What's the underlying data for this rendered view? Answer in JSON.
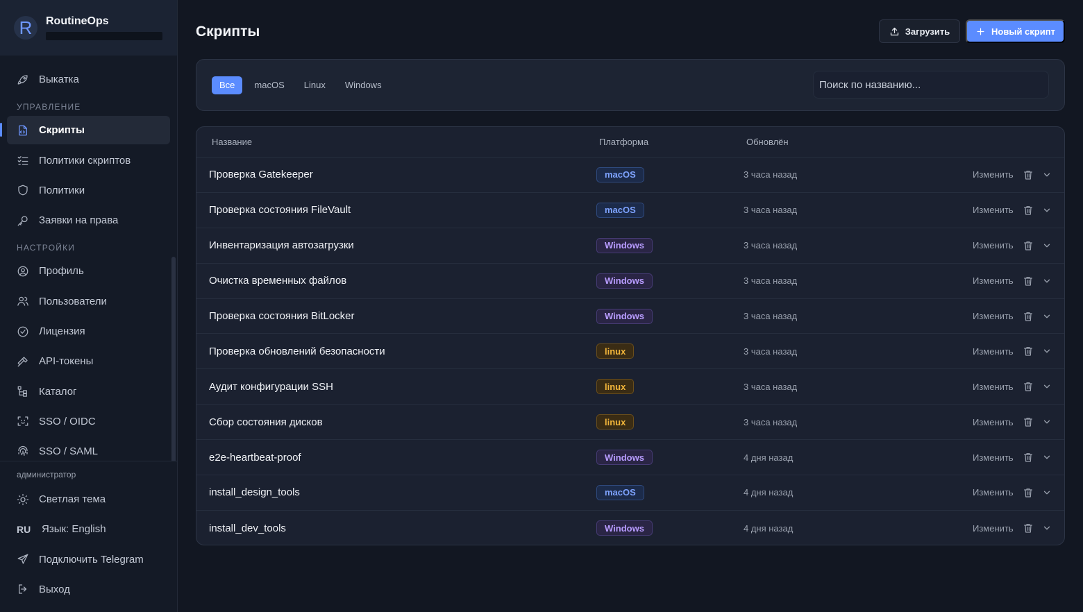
{
  "brand": {
    "name": "RoutineOps",
    "logo_letter": "R"
  },
  "sidebar": {
    "top_items": [
      {
        "label": "Выкатка",
        "icon": "rocket-icon"
      }
    ],
    "sections": [
      {
        "title": "УПРАВЛЕНИЕ",
        "items": [
          {
            "label": "Скрипты",
            "icon": "script-file-icon",
            "active": true
          },
          {
            "label": "Политики скриптов",
            "icon": "checklist-icon"
          },
          {
            "label": "Политики",
            "icon": "shield-icon"
          },
          {
            "label": "Заявки на права",
            "icon": "key-icon"
          }
        ]
      },
      {
        "title": "НАСТРОЙКИ",
        "items": [
          {
            "label": "Профиль",
            "icon": "user-circle-icon"
          },
          {
            "label": "Пользователи",
            "icon": "users-icon"
          },
          {
            "label": "Лицензия",
            "icon": "check-circle-icon"
          },
          {
            "label": "API-токены",
            "icon": "hammer-icon"
          },
          {
            "label": "Каталог",
            "icon": "tree-icon"
          },
          {
            "label": "SSO / OIDC",
            "icon": "face-scan-icon"
          },
          {
            "label": "SSO / SAML",
            "icon": "fingerprint-icon"
          }
        ]
      }
    ],
    "bottom": {
      "role": "администратор",
      "theme_label": "Светлая тема",
      "lang_code": "RU",
      "lang_label": "Язык: English",
      "telegram_label": "Подключить Telegram",
      "logout_label": "Выход"
    }
  },
  "header": {
    "title": "Скрипты",
    "upload_label": "Загрузить",
    "new_label": "Новый скрипт"
  },
  "filters": {
    "tabs": [
      "Все",
      "macOS",
      "Linux",
      "Windows"
    ],
    "active": "Все",
    "search_placeholder": "Поиск по названию..."
  },
  "table": {
    "columns": {
      "name": "Название",
      "platform": "Платформа",
      "updated": "Обновлён"
    },
    "edit_label": "Изменить",
    "rows": [
      {
        "name": "Проверка Gatekeeper",
        "platform": "macOS",
        "updated": "3 часа назад"
      },
      {
        "name": "Проверка состояния FileVault",
        "platform": "macOS",
        "updated": "3 часа назад"
      },
      {
        "name": "Инвентаризация автозагрузки",
        "platform": "Windows",
        "updated": "3 часа назад"
      },
      {
        "name": "Очистка временных файлов",
        "platform": "Windows",
        "updated": "3 часа назад"
      },
      {
        "name": "Проверка состояния BitLocker",
        "platform": "Windows",
        "updated": "3 часа назад"
      },
      {
        "name": "Проверка обновлений безопасности",
        "platform": "linux",
        "updated": "3 часа назад"
      },
      {
        "name": "Аудит конфигурации SSH",
        "platform": "linux",
        "updated": "3 часа назад"
      },
      {
        "name": "Сбор состояния дисков",
        "platform": "linux",
        "updated": "3 часа назад"
      },
      {
        "name": "e2e-heartbeat-proof",
        "platform": "Windows",
        "updated": "4 дня назад"
      },
      {
        "name": "install_design_tools",
        "platform": "macOS",
        "updated": "4 дня назад"
      },
      {
        "name": "install_dev_tools",
        "platform": "Windows",
        "updated": "4 дня назад"
      }
    ]
  },
  "colors": {
    "accent": "#5b8cff",
    "macos_badge": "#7ea3ff",
    "windows_badge": "#b89cff",
    "linux_badge": "#f0b43a"
  }
}
